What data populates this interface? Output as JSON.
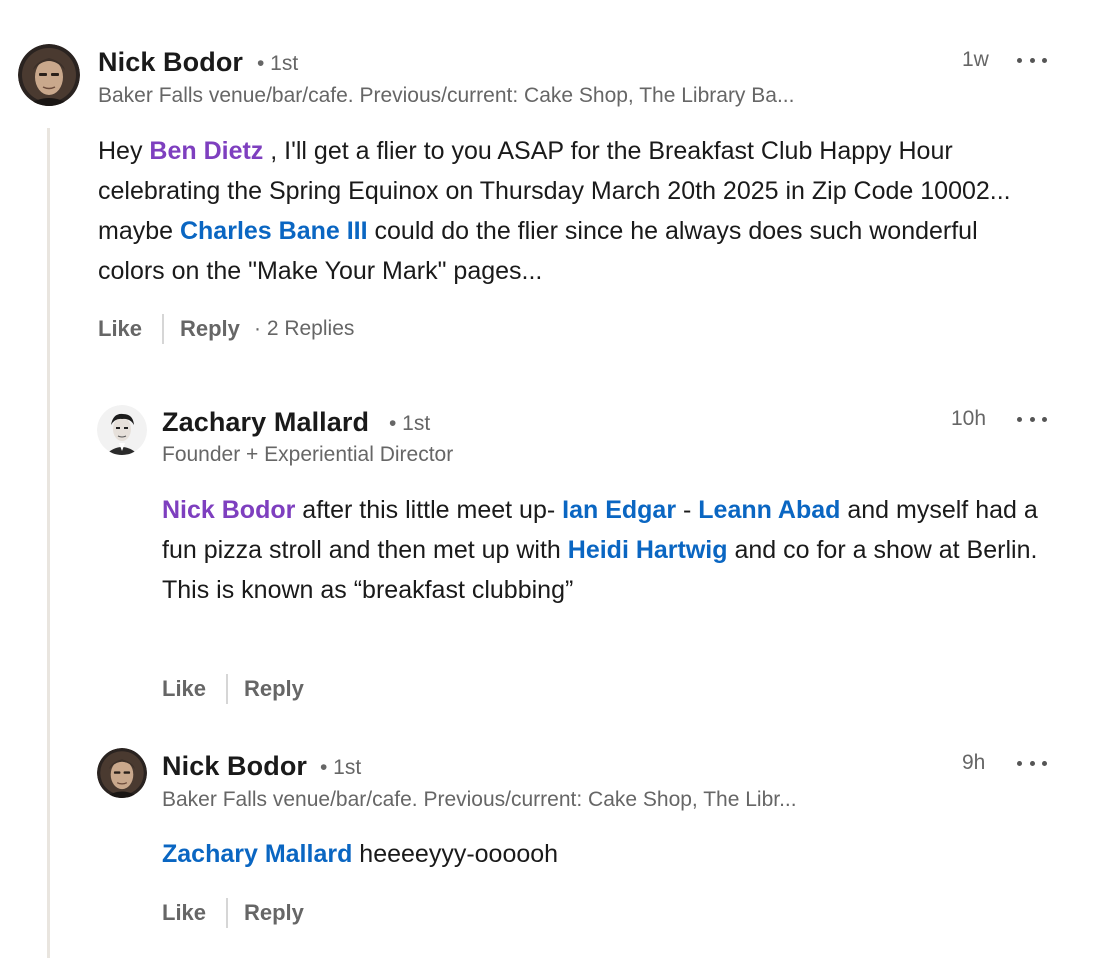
{
  "comments": [
    {
      "author": "Nick Bodor",
      "degree": "• 1st",
      "headline": "Baker Falls venue/bar/cafe. Previous/current: Cake Shop, The Library Ba...",
      "time": "1w",
      "body": {
        "p1": "Hey ",
        "m1": "Ben Dietz",
        "p2": " , I'll get a flier to you ASAP for the Breakfast Club Happy Hour celebrating the Spring Equinox on Thursday March 20th 2025 in Zip Code 10002... maybe ",
        "m2": "Charles Bane III",
        "p3": " could do the flier since he always does such wonderful colors on the \"Make Your Mark\" pages..."
      },
      "like_label": "Like",
      "reply_label": "Reply",
      "replies_count": "· 2 Replies"
    },
    {
      "author": "Zachary Mallard",
      "degree": "• 1st",
      "headline": "Founder + Experiential Director",
      "time": "10h",
      "body": {
        "m1": "Nick Bodor",
        "p1": " after this little meet up- ",
        "m2": "Ian Edgar",
        "p2": " - ",
        "m3": "Leann Abad",
        "p3": " and myself had a fun pizza stroll and then met up with ",
        "m4": "Heidi Hartwig",
        "p4": " and co for a show at Berlin.",
        "line2": "This is known as “breakfast clubbing”"
      },
      "like_label": "Like",
      "reply_label": "Reply"
    },
    {
      "author": "Nick Bodor",
      "degree": "• 1st",
      "headline": "Baker Falls venue/bar/cafe. Previous/current: Cake Shop, The Libr...",
      "time": "9h",
      "body": {
        "m1": "Zachary Mallard",
        "p1": " heeeeyyy-oooooh"
      },
      "like_label": "Like",
      "reply_label": "Reply"
    }
  ],
  "icons": {
    "more": "more-options-icon",
    "avatar_nick": "avatar-nick-bodor",
    "avatar_zachary": "avatar-zachary-mallard"
  },
  "colors": {
    "mention_purple": "#7e3fbf",
    "mention_blue": "#0a66c2",
    "muted": "#666666",
    "thread_line": "#e9e5df"
  }
}
